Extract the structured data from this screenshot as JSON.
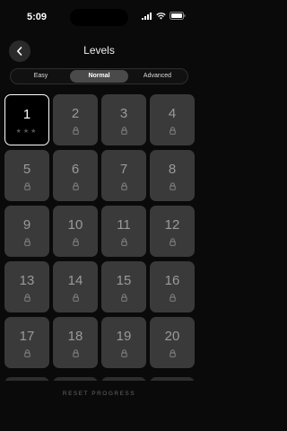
{
  "status": {
    "time": "5:09"
  },
  "header": {
    "title": "Levels"
  },
  "tabs": [
    {
      "label": "Easy",
      "active": false
    },
    {
      "label": "Normal",
      "active": true
    },
    {
      "label": "Advanced",
      "active": false
    }
  ],
  "levels": [
    {
      "number": "1",
      "locked": false,
      "stars": "★★★"
    },
    {
      "number": "2",
      "locked": true
    },
    {
      "number": "3",
      "locked": true
    },
    {
      "number": "4",
      "locked": true
    },
    {
      "number": "5",
      "locked": true
    },
    {
      "number": "6",
      "locked": true
    },
    {
      "number": "7",
      "locked": true
    },
    {
      "number": "8",
      "locked": true
    },
    {
      "number": "9",
      "locked": true
    },
    {
      "number": "10",
      "locked": true
    },
    {
      "number": "11",
      "locked": true
    },
    {
      "number": "12",
      "locked": true
    },
    {
      "number": "13",
      "locked": true
    },
    {
      "number": "14",
      "locked": true
    },
    {
      "number": "15",
      "locked": true
    },
    {
      "number": "16",
      "locked": true
    },
    {
      "number": "17",
      "locked": true
    },
    {
      "number": "18",
      "locked": true
    },
    {
      "number": "19",
      "locked": true
    },
    {
      "number": "20",
      "locked": true
    }
  ],
  "footer": {
    "reset_label": "RESET PROGRESS"
  },
  "colors": {
    "background": "#0a0a0a",
    "locked_tile": "#3a3a3a",
    "unlocked_border": "#ffffff"
  },
  "icons": {
    "back": "chevron-left-icon",
    "lock": "lock-icon"
  }
}
